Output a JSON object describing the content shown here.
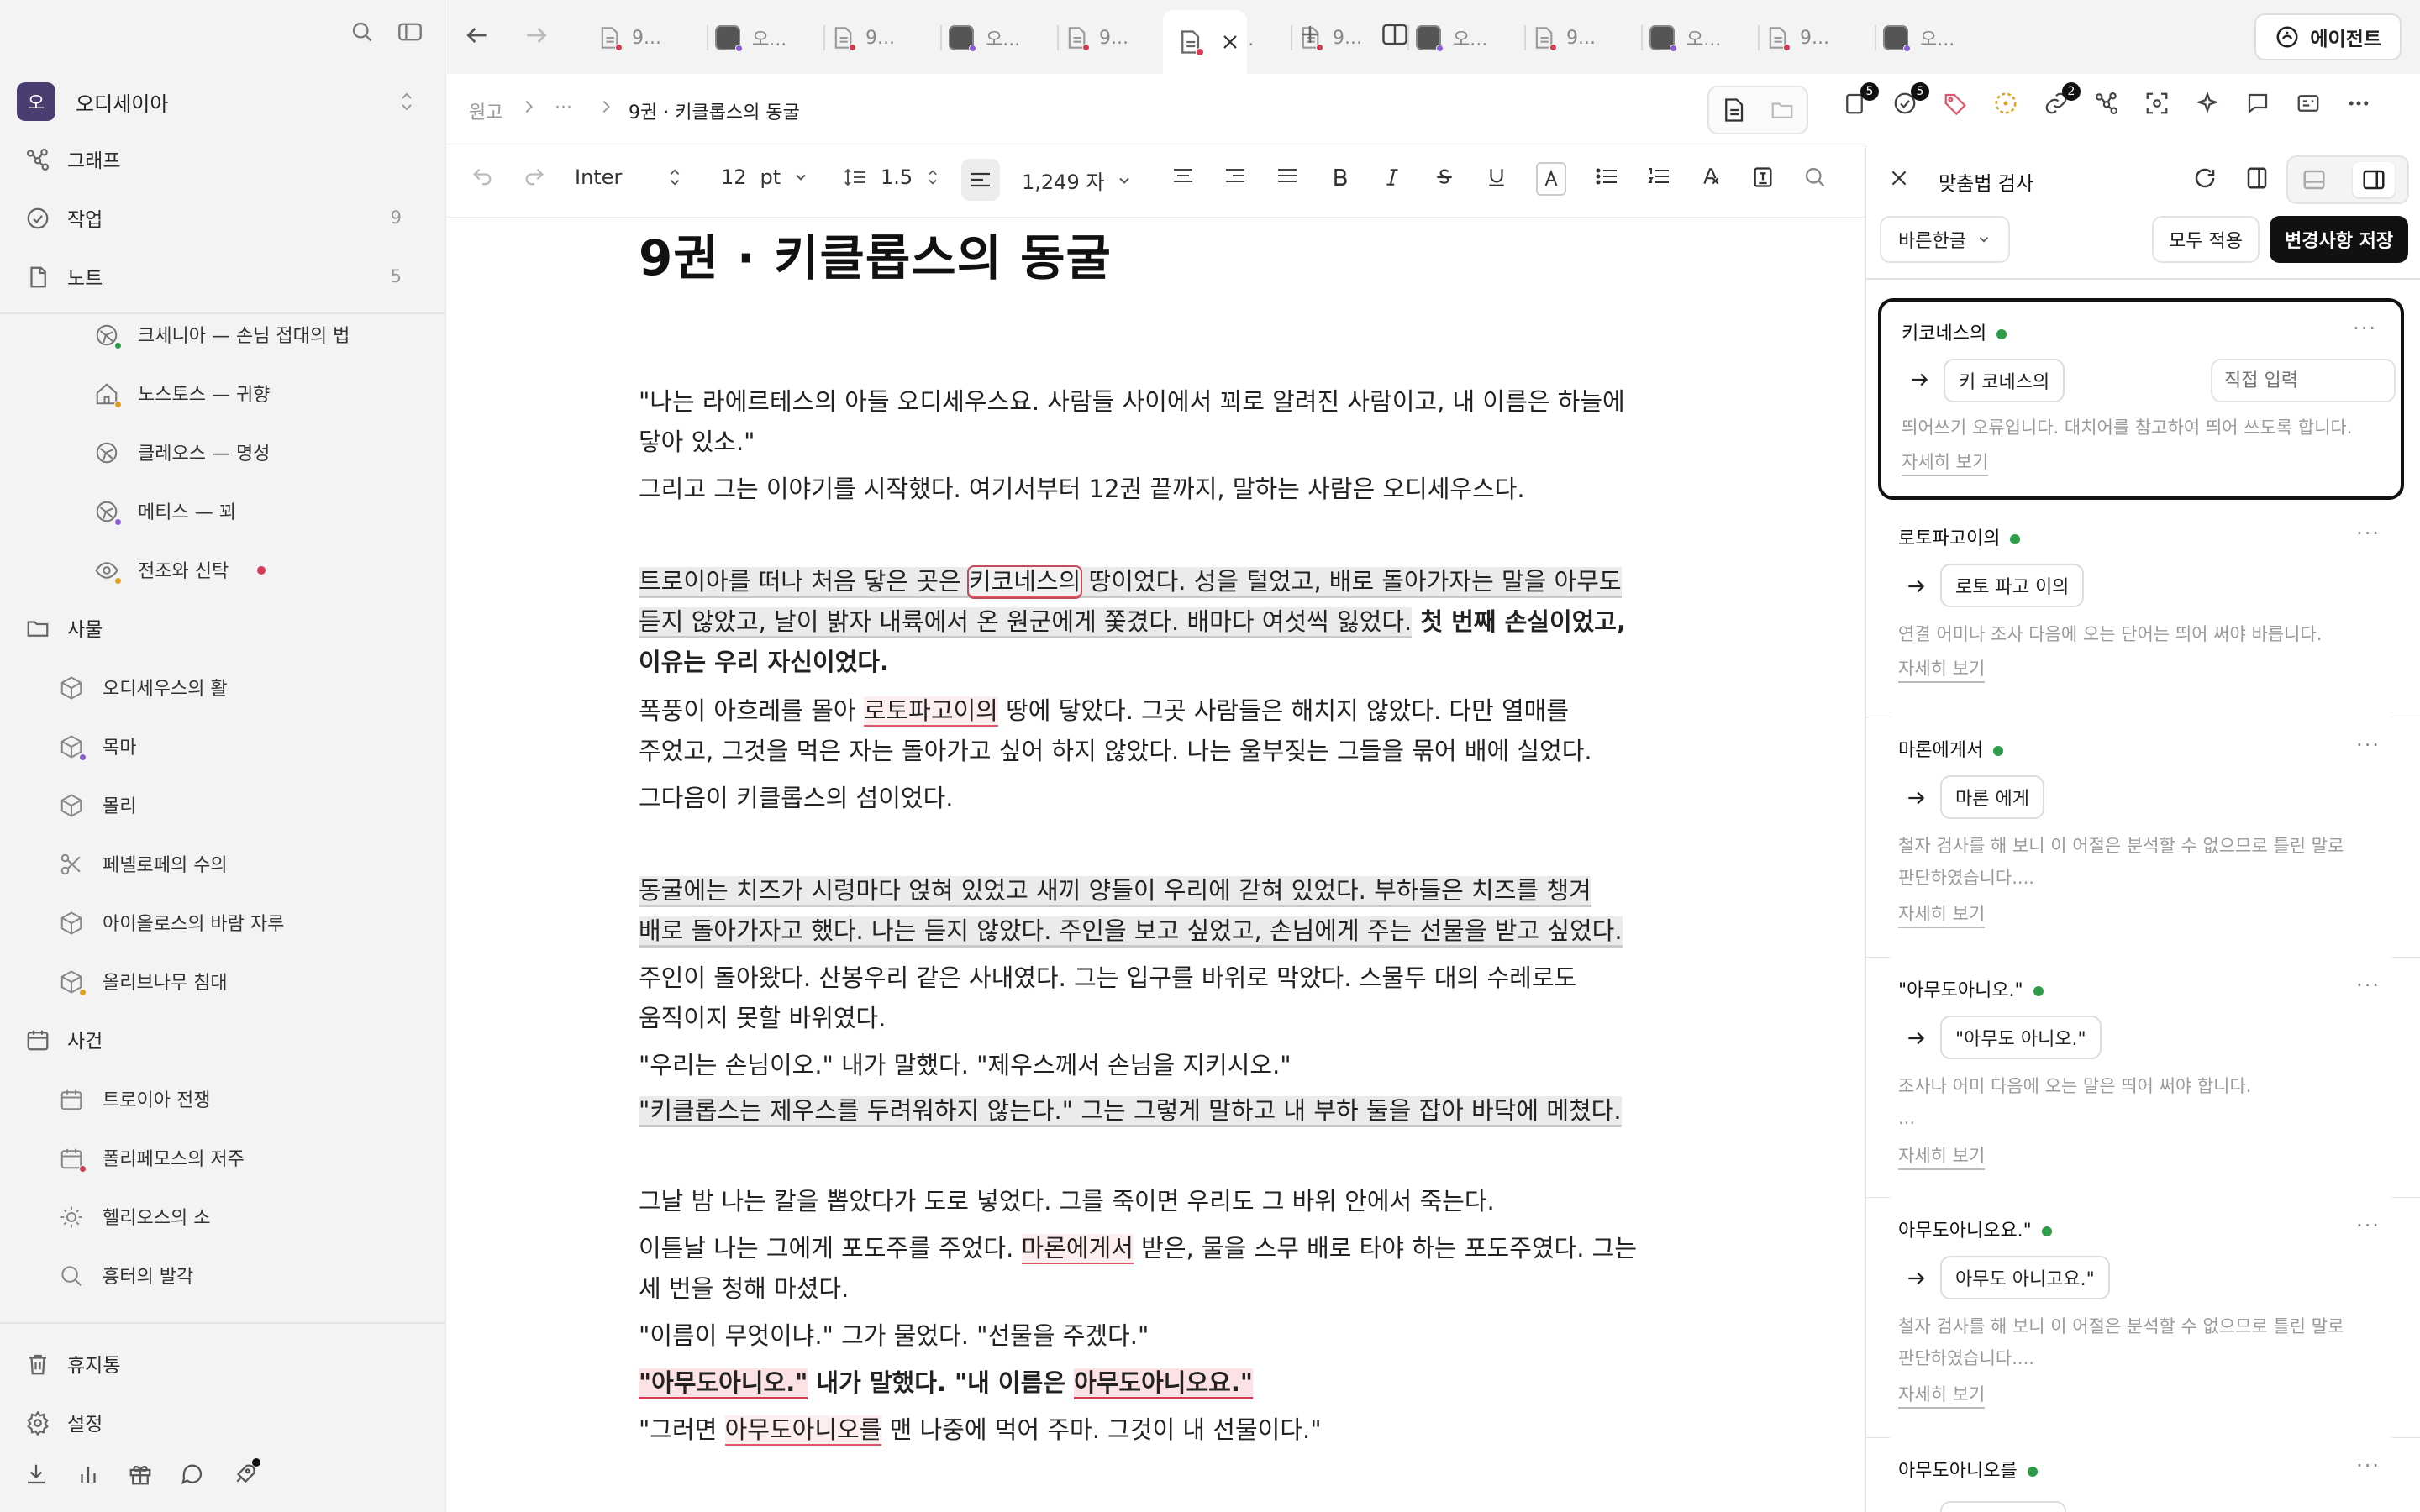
{
  "sidebar": {
    "workspace_initial": "오",
    "workspace_name": "오디세이아",
    "nav": [
      {
        "label": "그래프",
        "icon": "graph-icon"
      },
      {
        "label": "작업",
        "count": "9",
        "icon": "check-circle-icon"
      },
      {
        "label": "노트",
        "count": "5",
        "icon": "note-icon"
      }
    ],
    "notes": [
      {
        "label": "크세니아 — 손님 접대의 법",
        "icon": "graph-icon"
      },
      {
        "label": "노스토스 — 귀향",
        "icon": "home-icon"
      },
      {
        "label": "클레오스 — 명성",
        "icon": "graph-icon"
      },
      {
        "label": "메티스 — 꾀",
        "icon": "graph-icon"
      },
      {
        "label": "전조와 신탁",
        "icon": "eye-icon"
      }
    ],
    "things_header": "사물",
    "things": [
      {
        "label": "오디세우스의 활"
      },
      {
        "label": "목마"
      },
      {
        "label": "몰리"
      },
      {
        "label": "페넬로페의 수의"
      },
      {
        "label": "아이올로스의 바람 자루"
      },
      {
        "label": "올리브나무 침대"
      }
    ],
    "events_header": "사건",
    "events": [
      {
        "label": "트로이아 전쟁"
      },
      {
        "label": "폴리페모스의 저주"
      },
      {
        "label": "헬리오스의 소"
      },
      {
        "label": "흉터의 발각"
      }
    ],
    "trash": "휴지통",
    "settings": "설정"
  },
  "tabs": {
    "items": [
      {
        "label": "9...",
        "kind": "doc"
      },
      {
        "label": "오...",
        "kind": "avatar"
      },
      {
        "label": "9...",
        "kind": "doc"
      },
      {
        "label": "오...",
        "kind": "avatar"
      },
      {
        "label": "9...",
        "kind": "doc"
      },
      {
        "label": "오...",
        "kind": "avatar"
      },
      {
        "label": "9...",
        "kind": "doc"
      },
      {
        "label": "오...",
        "kind": "avatar"
      },
      {
        "label": "9...",
        "kind": "doc"
      },
      {
        "label": "오...",
        "kind": "avatar"
      },
      {
        "label": "9...",
        "kind": "doc"
      },
      {
        "label": "오...",
        "kind": "avatar"
      }
    ],
    "agent_label": "에이전트"
  },
  "breadcrumb": {
    "root": "원고",
    "ellipsis": "···",
    "current": "9권 · 키클롭스의 동굴"
  },
  "header_badges": {
    "pages": "5",
    "tasks": "5",
    "links": "2"
  },
  "toolbar": {
    "font": "Inter",
    "size": "12",
    "unit": "pt",
    "line_height": "1.5",
    "char_count": "1,249 자"
  },
  "document": {
    "title": "9권 · 키클롭스의 동굴",
    "p1a": "\"나는 라에르테스의 아들 오디세우스요. 사람들 사이에서 꾀로 알려진 사람이고, 내 이름은 하늘에",
    "p1b": "닿아 있소.\"",
    "p2": "그리고 그는 이야기를 시작했다. 여기서부터 12권 끝까지, 말하는 사람은 오디세우스다.",
    "p3a_pre": "트로이아를 떠나 처음 닿은 곳은 ",
    "p3a_err": "키코네스의",
    "p3a_post": " 땅이었다. 성을 털었고, 배로 돌아가자는 말을 아무도",
    "p3b": "듣지 않았고, 날이 밝자 내륙에서 온 원군에게 쫓겼다. 배마다 여섯씩 잃었다.",
    "p3b_bold": " 첫 번째 손실이었고,",
    "p3c_bold": "이유는 우리 자신이었다.",
    "p4a_pre": "폭풍이 아흐레를 몰아 ",
    "p4a_err": "로토파고이의",
    "p4a_post": " 땅에 닿았다. 그곳 사람들은 해치지 않았다. 다만 열매를",
    "p4b": "주었고, 그것을 먹은 자는 돌아가고 싶어 하지 않았다. 나는 울부짖는 그들을 묶어 배에 실었다.",
    "p5": "그다음이 키클롭스의 섬이었다.",
    "p6a": "동굴에는 치즈가 시렁마다 얹혀 있었고 새끼 양들이 우리에 갇혀 있었다. 부하들은 치즈를 챙겨",
    "p6b": "배로 돌아가자고 했다. 나는 듣지 않았다. 주인을 보고 싶었고, 손님에게 주는 선물을 받고 싶었다.",
    "p7a": "주인이 돌아왔다. 산봉우리 같은 사내였다. 그는 입구를 바위로 막았다. 스물두 대의 수레로도",
    "p7b": "움직이지 못할 바위였다.",
    "p8": "\"우리는 손님이오.\" 내가 말했다. \"제우스께서 손님을 지키시오.\"",
    "p9": "\"키클롭스는 제우스를 두려워하지 않는다.\" 그는 그렇게 말하고 내 부하 둘을 잡아 바닥에 메쳤다.",
    "p10": "그날 밤 나는 칼을 뽑았다가 도로 넣었다. 그를 죽이면 우리도 그 바위 안에서 죽는다.",
    "p11a_pre": "이튿날 나는 그에게 포도주를 주었다. ",
    "p11a_err": "마론에게서",
    "p11a_post": " 받은, 물을 스무 배로 타야 하는 포도주였다. 그는",
    "p11b": "세 번을 청해 마셨다.",
    "p12": "\"이름이 무엇이냐.\" 그가 물었다. \"선물을 주겠다.\"",
    "p13_err1": "\"아무도아니오.\"",
    "p13_mid": " 내가 말했다. \"내 이름은 ",
    "p13_err2": "아무도아니오요.\"",
    "p14_pre": "\"그러면 ",
    "p14_err": "아무도아니오를",
    "p14_post": " 맨 나중에 먹어 주마. 그것이 내 선물이다.\""
  },
  "spellcheck": {
    "title": "맞춤법 검사",
    "engine": "바른한글",
    "apply_all": "모두 적용",
    "save": "변경사항 저장",
    "direct_placeholder": "직접 입력",
    "more_label": "자세히 보기",
    "cards": [
      {
        "word": "키코네스의",
        "suggestion": "키 코네스의",
        "desc1": "띄어쓰기 오류입니다. 대치어를 참고하여 띄어 쓰도록 합니다.",
        "desc2": ""
      },
      {
        "word": "로토파고이의",
        "suggestion": "로토 파고 이의",
        "desc1": "연결 어미나 조사 다음에 오는 단어는 띄어 써야 바릅니다.",
        "desc2": ""
      },
      {
        "word": "마론에게서",
        "suggestion": "마론 에게",
        "desc1": "철자 검사를 해 보니 이 어절은 분석할 수 없으므로 틀린 말로",
        "desc2": "판단하였습니다...."
      },
      {
        "word": "\"아무도아니오.\"",
        "suggestion": "\"아무도 아니오.\"",
        "desc1": "조사나 어미 다음에 오는 말은 띄어 써야 합니다.",
        "desc2": "..."
      },
      {
        "word": "아무도아니오요.\"",
        "suggestion": "아무도 아니고요.\"",
        "desc1": "철자 검사를 해 보니 이 어절은 분석할 수 없으므로 틀린 말로",
        "desc2": "판단하였습니다...."
      },
      {
        "word": "아무도아니오를",
        "suggestion": "",
        "desc1": "",
        "desc2": ""
      }
    ]
  },
  "colors": {
    "accent_dark": "#111111",
    "ok_dot": "#2d9d4a",
    "error": "#d43c55",
    "workspace": "#4a3e70"
  }
}
